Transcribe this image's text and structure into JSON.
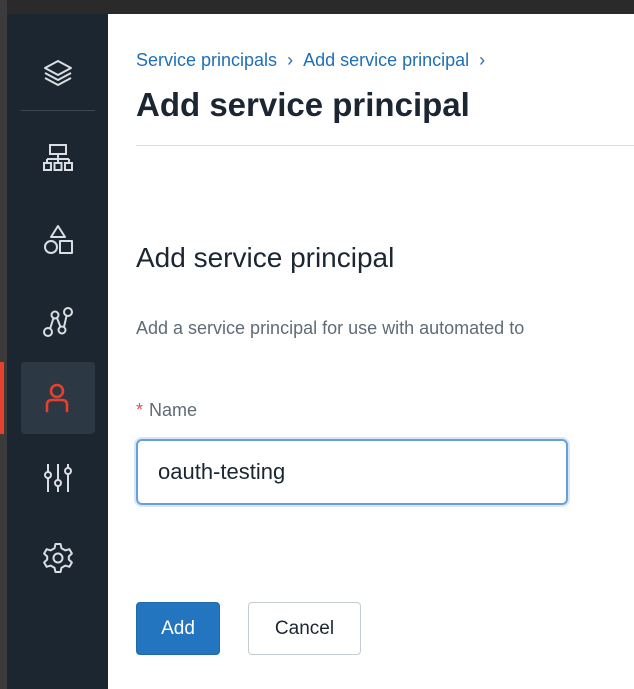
{
  "breadcrumb": {
    "items": [
      "Service principals",
      "Add service principal"
    ],
    "separator": "›"
  },
  "page": {
    "title": "Add service principal"
  },
  "form": {
    "title": "Add service principal",
    "description": "Add a service principal for use with automated to",
    "name_required_marker": "*",
    "name_label": "Name",
    "name_value": "oauth-testing"
  },
  "buttons": {
    "add_label": "Add",
    "cancel_label": "Cancel"
  },
  "sidebar": {
    "icons": [
      "layers-icon",
      "hierarchy-icon",
      "shapes-icon",
      "workflow-icon",
      "user-icon",
      "sliders-icon",
      "gear-icon"
    ],
    "active": "user-icon"
  },
  "colors": {
    "sidebar_bg": "#1c2630",
    "accent_red": "#e8402d",
    "link_blue": "#1f6fb8",
    "primary_button": "#2375c0"
  }
}
